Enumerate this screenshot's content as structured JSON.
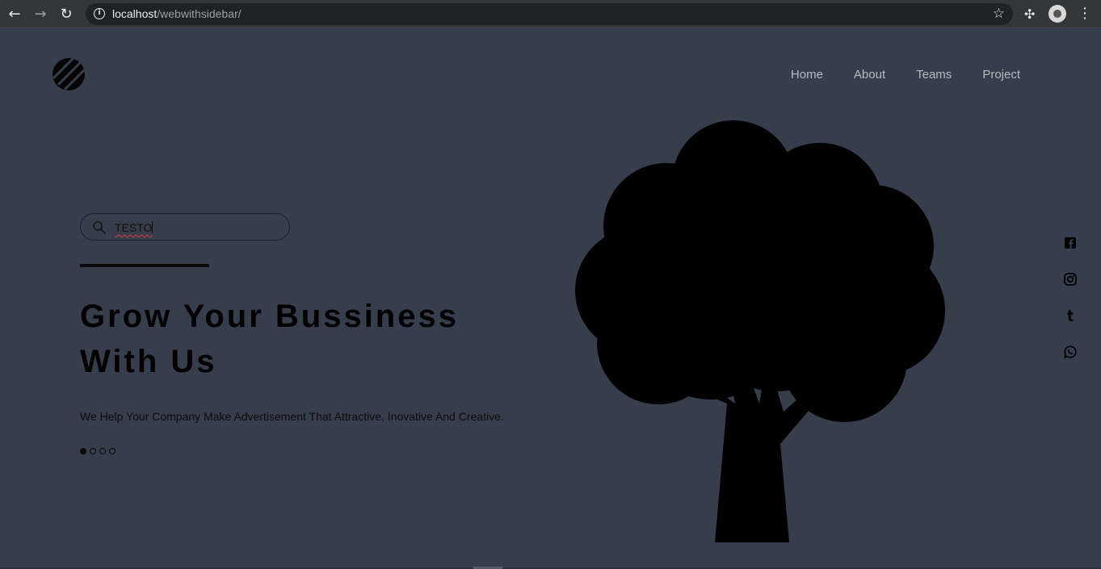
{
  "browser": {
    "url_host": "localhost",
    "url_path": "/webwithsidebar/"
  },
  "nav": {
    "items": [
      "Home",
      "About",
      "Teams",
      "Project"
    ]
  },
  "search": {
    "value": "TESTO"
  },
  "hero": {
    "headline_line1": "Grow Your Bussiness",
    "headline_line2": "With Us",
    "subtitle": "We Help Your Company Make Advertisement That Attractive, Inovative And Creative.",
    "slide_count": 4,
    "active_slide": 1
  },
  "social": {
    "icons": [
      "facebook-icon",
      "instagram-icon",
      "tumblr-icon",
      "whatsapp-icon"
    ]
  },
  "colors": {
    "background": "#363d4b",
    "nav_text": "#b6bac3",
    "foreground": "#000000"
  }
}
